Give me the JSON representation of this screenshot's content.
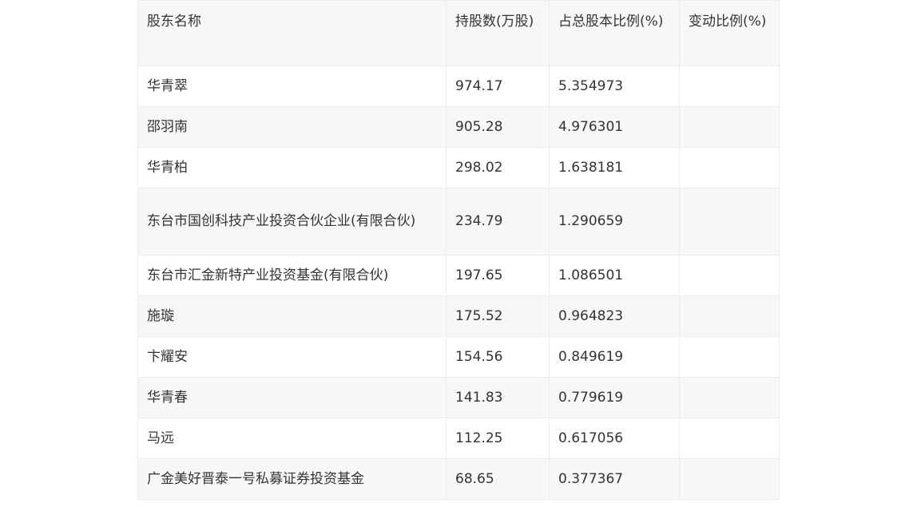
{
  "table": {
    "headers": [
      "股东名称",
      "持股数(万股)",
      "占总股本比例(%)",
      "变动比例(%)"
    ],
    "rows": [
      {
        "name": "华青翠",
        "shares": "974.17",
        "ratio": "5.354973",
        "change": ""
      },
      {
        "name": "邵羽南",
        "shares": "905.28",
        "ratio": "4.976301",
        "change": ""
      },
      {
        "name": "华青柏",
        "shares": "298.02",
        "ratio": "1.638181",
        "change": ""
      },
      {
        "name": "东台市国创科技产业投资合伙企业(有限合伙)",
        "shares": "234.79",
        "ratio": "1.290659",
        "change": ""
      },
      {
        "name": "东台市汇金新特产业投资基金(有限合伙)",
        "shares": "197.65",
        "ratio": "1.086501",
        "change": ""
      },
      {
        "name": "施璇",
        "shares": "175.52",
        "ratio": "0.964823",
        "change": ""
      },
      {
        "name": "卞耀安",
        "shares": "154.56",
        "ratio": "0.849619",
        "change": ""
      },
      {
        "name": "华青春",
        "shares": "141.83",
        "ratio": "0.779619",
        "change": ""
      },
      {
        "name": "马远",
        "shares": "112.25",
        "ratio": "0.617056",
        "change": ""
      },
      {
        "name": "广金美好晋泰一号私募证券投资基金",
        "shares": "68.65",
        "ratio": "0.377367",
        "change": ""
      }
    ]
  }
}
